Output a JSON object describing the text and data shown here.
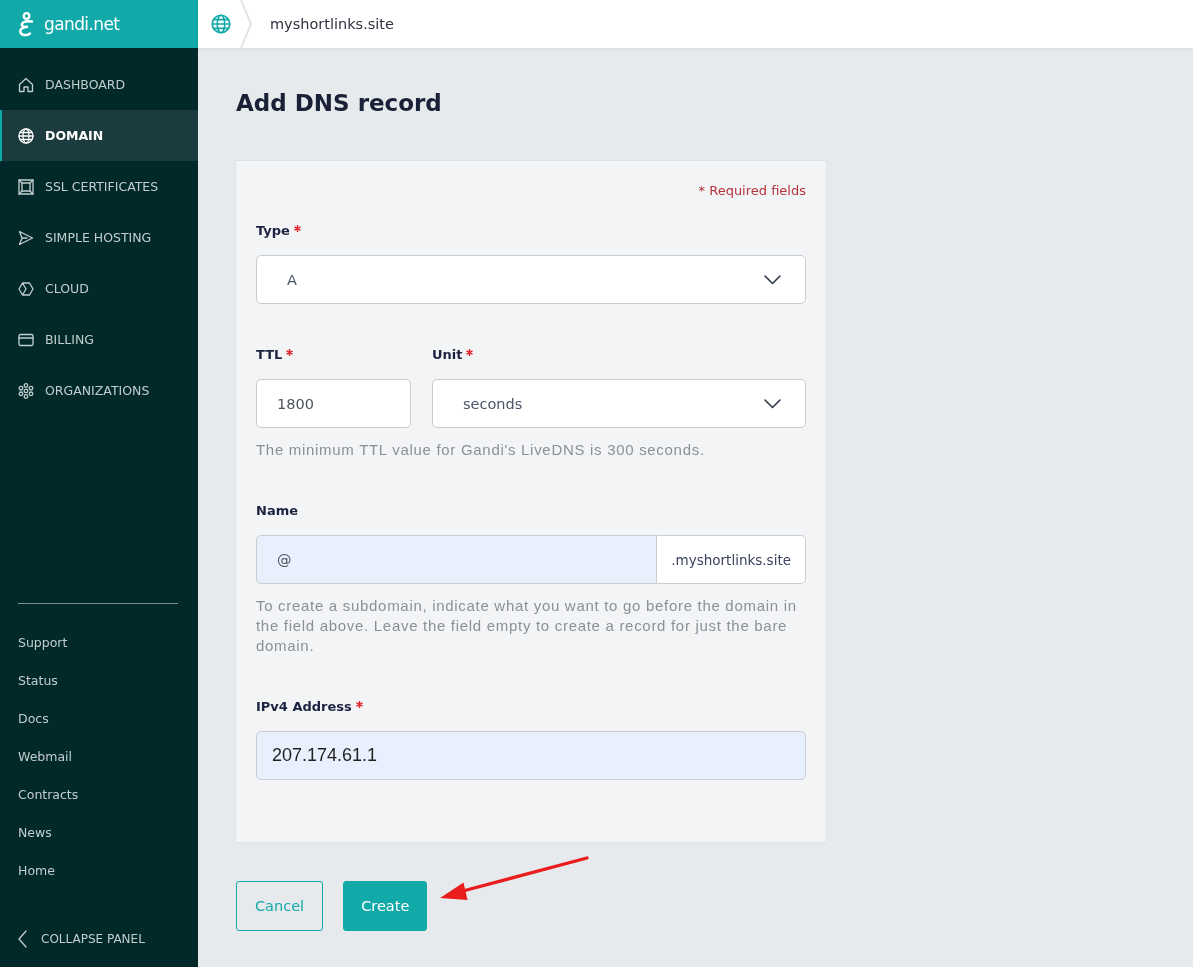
{
  "sidebar": {
    "logo": "gandi.net",
    "nav": [
      {
        "label": "DASHBOARD",
        "selected": false
      },
      {
        "label": "DOMAIN",
        "selected": true
      },
      {
        "label": "SSL CERTIFICATES",
        "selected": false
      },
      {
        "label": "SIMPLE HOSTING",
        "selected": false
      },
      {
        "label": "CLOUD",
        "selected": false
      },
      {
        "label": "BILLING",
        "selected": false
      },
      {
        "label": "ORGANIZATIONS",
        "selected": false
      }
    ],
    "links": [
      "Support",
      "Status",
      "Docs",
      "Webmail",
      "Contracts",
      "News",
      "Home"
    ],
    "collapse": "COLLAPSE PANEL"
  },
  "topbar": {
    "breadcrumb": "myshortlinks.site"
  },
  "page": {
    "title": "Add DNS record"
  },
  "form": {
    "required_note": "* Required fields",
    "sections": [
      {
        "fields": [
          {
            "label": "Type",
            "required": true,
            "kind": "select",
            "value": "A"
          }
        ]
      },
      {
        "fields": [
          {
            "label": "TTL",
            "required": true,
            "kind": "input",
            "value": "1800",
            "autofilled": false
          },
          {
            "label": "Unit",
            "required": true,
            "kind": "select",
            "value": "seconds"
          }
        ],
        "help": "The minimum TTL value for Gandi's LiveDNS is 300 seconds."
      },
      {
        "fields": [
          {
            "label": "Name",
            "required": false,
            "kind": "suffixed",
            "value": "@",
            "suffix": ".myshortlinks.site",
            "autofilled": true
          }
        ],
        "help": "To create a subdomain, indicate what you want to go before the domain in the field above. Leave the field empty to create a record for just the bare domain."
      },
      {
        "fields": [
          {
            "label": "IPv4 Address",
            "required": true,
            "kind": "input",
            "value": "207.174.61.1",
            "autofilled": true
          }
        ]
      }
    ]
  },
  "buttons": [
    {
      "label": "Cancel",
      "kind": "secondary"
    },
    {
      "label": "Create",
      "kind": "primary"
    }
  ]
}
